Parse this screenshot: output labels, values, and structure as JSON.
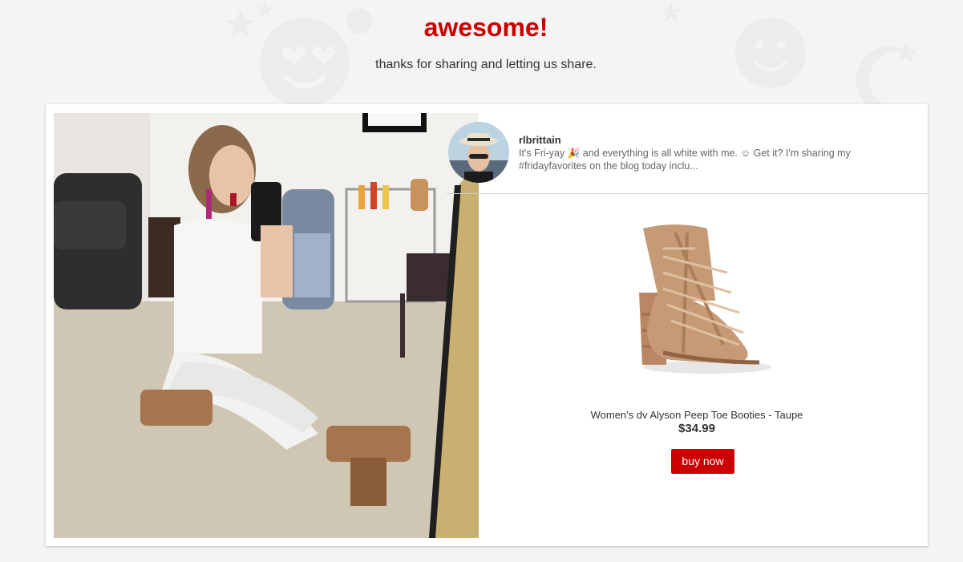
{
  "header": {
    "title": "awesome!",
    "subtitle": "thanks for sharing and letting us share."
  },
  "post": {
    "username": "rlbrittain",
    "caption": "It's Fri-yay 🎉 and everything is all white with me. ☺ Get it? I'm sharing my #fridayfavorites on the blog today inclu...",
    "photo_icon": "mirror-selfie-photo",
    "avatar_icon": "user-avatar"
  },
  "product": {
    "name": "Women's dv Alyson Peep Toe Booties - Taupe",
    "price": "$34.99",
    "buy_label": "buy now",
    "image_icon": "taupe-bootie"
  },
  "colors": {
    "accent": "#cc0000",
    "background": "#f4f4f4",
    "card": "#ffffff",
    "text": "#333333",
    "muted_text": "#666666",
    "bootie": "#c79a76"
  }
}
